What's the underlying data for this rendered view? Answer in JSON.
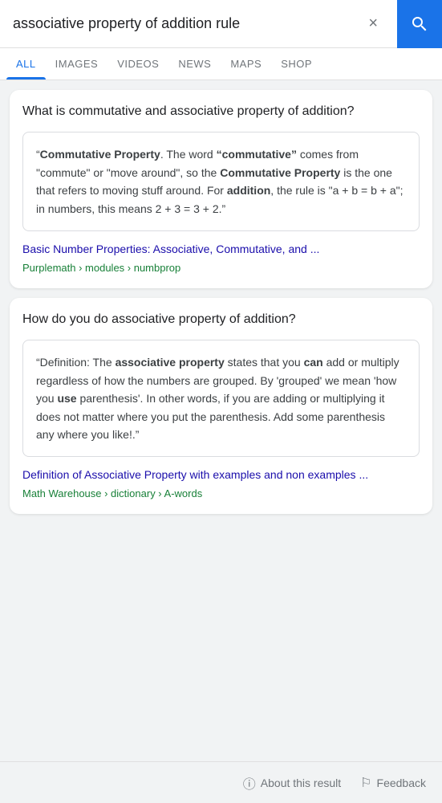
{
  "search": {
    "query": "associative property of addition rule",
    "clear_label": "×",
    "placeholder": "Search"
  },
  "tabs": [
    {
      "label": "ALL",
      "active": true
    },
    {
      "label": "IMAGES",
      "active": false
    },
    {
      "label": "VIDEOS",
      "active": false
    },
    {
      "label": "NEWS",
      "active": false
    },
    {
      "label": "MAPS",
      "active": false
    },
    {
      "label": "SHOP",
      "active": false
    }
  ],
  "cards": [
    {
      "question": "What is commutative and associative property of addition?",
      "quote": {
        "open_quote": "“",
        "part1": "Commutative Property",
        "part1_bold": true,
        "part2": ". The word ",
        "part3": "“commutative”",
        "part3_bold": true,
        "part4": " comes from \"commute\" or \"move around\", so the ",
        "part5": "Commutative Property",
        "part5_bold": true,
        "part6": " is the one that refers to moving stuff around. For ",
        "part7": "addition",
        "part7_bold": true,
        "part8": ", the rule is “a + b = b + a”; in numbers, this means 2 + 3 = 3 + 2.”"
      },
      "link_text": "Basic Number Properties: Associative, Commutative, and ...",
      "link_source": "Purplemath › modules › numbprop"
    },
    {
      "question": "How do you do associative property of addition?",
      "quote": {
        "open_quote": "“",
        "part1": "Definition: The ",
        "part2": "associative property",
        "part2_bold": true,
        "part3": " states that you ",
        "part4": "can",
        "part4_bold": true,
        "part5": " add or multiply regardless of how the numbers are grouped. By 'grouped' we mean 'how you ",
        "part6": "use",
        "part6_bold": true,
        "part7": " parenthesis'. In other words, if you are adding or multiplying it does not matter where you put the parenthesis. Add some parenthesis any where you like!.”"
      },
      "link_text": "Definition of Associative Property with examples and non examples ...",
      "link_source": "Math Warehouse › dictionary › A-words"
    }
  ],
  "footer": {
    "about_label": "About this result",
    "feedback_label": "Feedback"
  }
}
